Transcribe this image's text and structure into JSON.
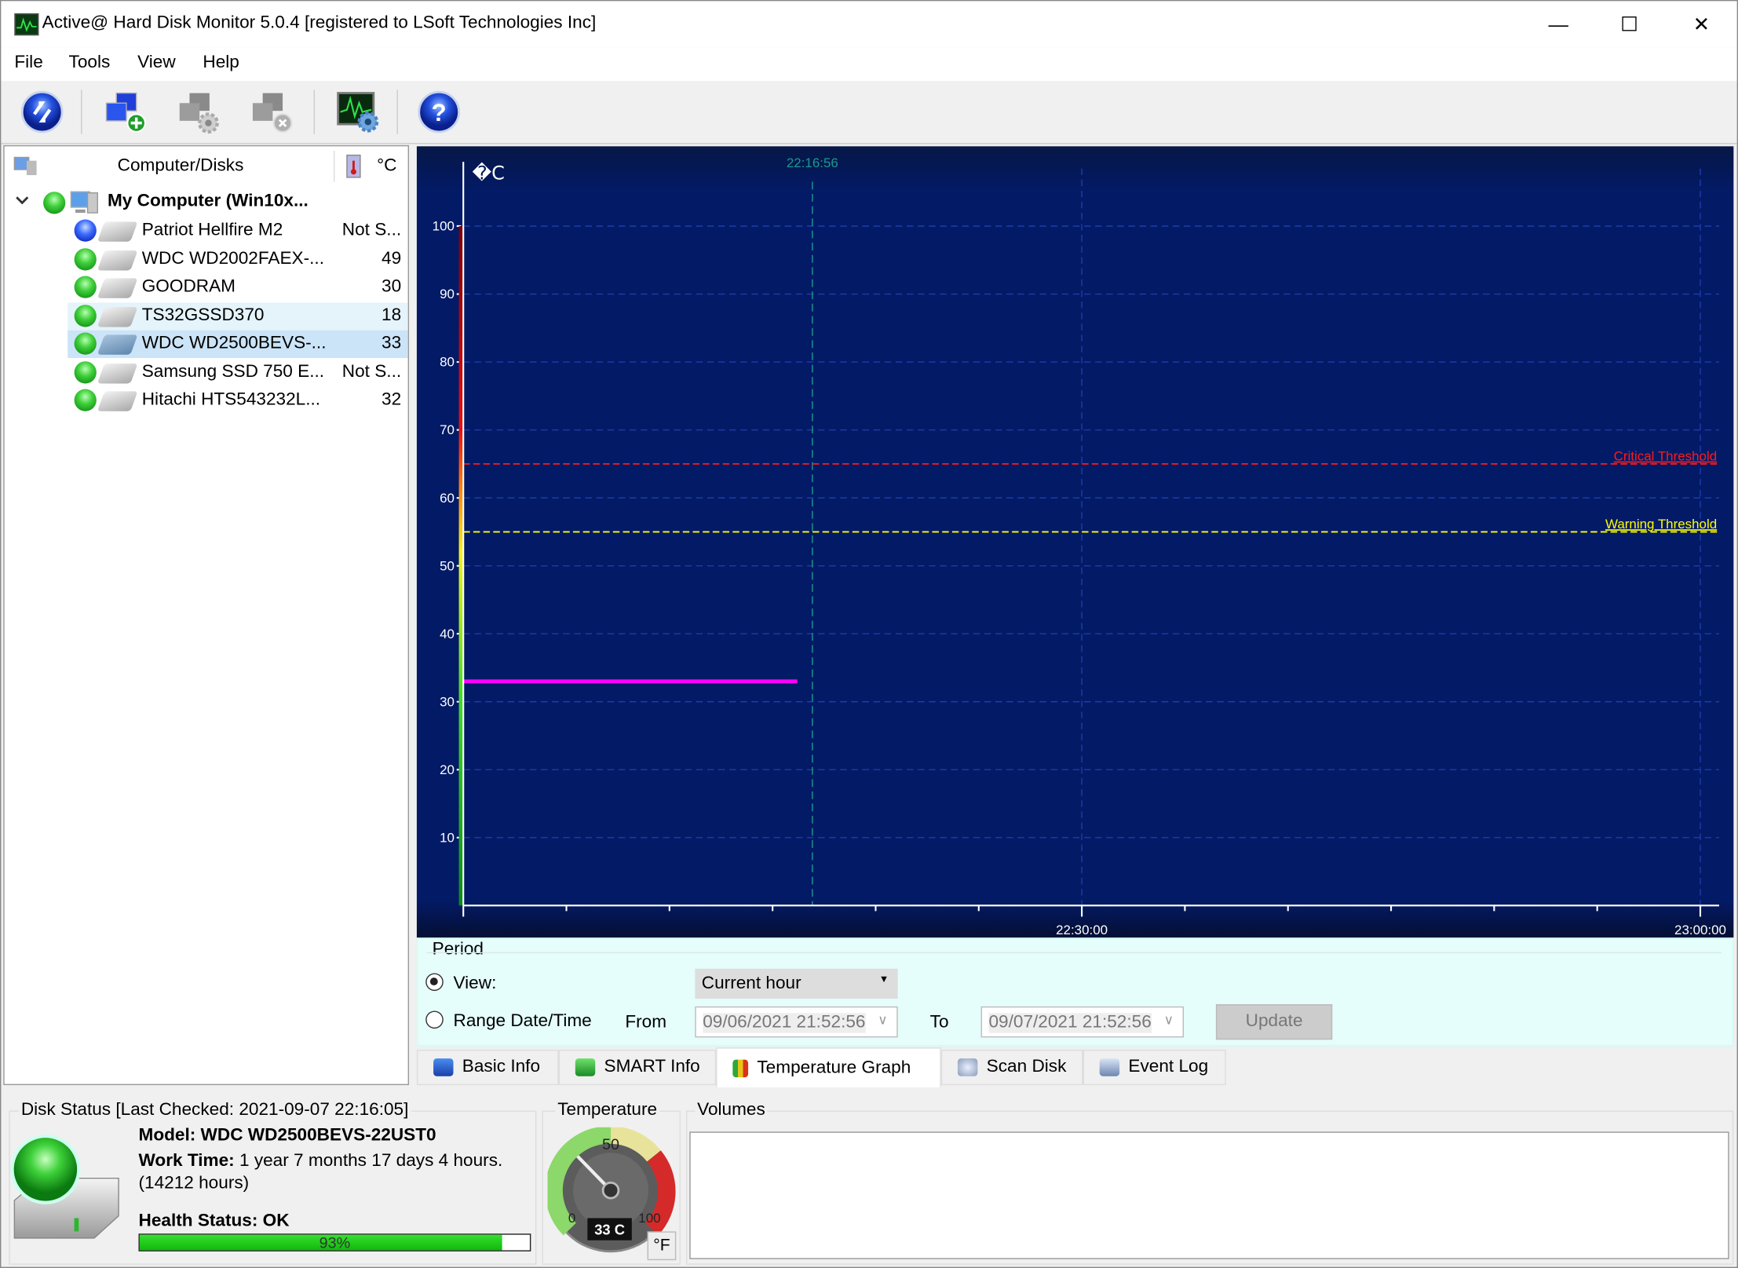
{
  "window": {
    "title": "Active@ Hard Disk Monitor 5.0.4 [registered to LSoft Technologies Inc]",
    "minimize_glyph": "—",
    "maximize_glyph": "☐",
    "close_glyph": "✕"
  },
  "menu": [
    "File",
    "Tools",
    "View",
    "Help"
  ],
  "toolbar": {
    "buttons": [
      {
        "name": "refresh",
        "icon": "refresh-icon"
      },
      {
        "name": "add-computer",
        "icon": "add-computer-icon"
      },
      {
        "name": "computer-settings",
        "icon": "computer-settings-icon"
      },
      {
        "name": "remove-computer",
        "icon": "remove-computer-icon"
      },
      {
        "name": "monitor-settings",
        "icon": "monitor-settings-icon"
      },
      {
        "name": "help",
        "icon": "help-icon"
      }
    ]
  },
  "tree": {
    "header_label": "Computer/Disks",
    "header_unit": "°C",
    "root": {
      "label": "My Computer (Win10x...",
      "status": "green",
      "expanded": true
    },
    "disks": [
      {
        "label": "Patriot Hellfire M2",
        "temp": "Not S...",
        "status": "blue",
        "state": ""
      },
      {
        "label": "WDC WD2002FAEX-...",
        "temp": "49",
        "status": "green",
        "state": ""
      },
      {
        "label": "GOODRAM",
        "temp": "30",
        "status": "green",
        "state": ""
      },
      {
        "label": "TS32GSSD370",
        "temp": "18",
        "status": "green",
        "state": "hover"
      },
      {
        "label": "WDC WD2500BEVS-...",
        "temp": "33",
        "status": "green",
        "state": "selected"
      },
      {
        "label": "Samsung SSD 750 E...",
        "temp": "Not S...",
        "status": "green",
        "state": ""
      },
      {
        "label": "Hitachi HTS543232L...",
        "temp": "32",
        "status": "green",
        "state": ""
      }
    ]
  },
  "chart_data": {
    "type": "line",
    "title": "",
    "ylabel": "�C",
    "xlabel": "",
    "ylim": [
      0,
      110
    ],
    "yticks": [
      10,
      20,
      30,
      40,
      50,
      60,
      70,
      80,
      90,
      100
    ],
    "xlim_minutes": [
      0,
      61
    ],
    "x_origin": "22:00:00",
    "xticks_minutes": [
      0,
      5,
      10,
      15,
      20,
      25,
      30,
      35,
      40,
      45,
      50,
      55,
      60
    ],
    "xtick_labels": {
      "30": "22:30:00",
      "60": "23:00:00"
    },
    "current_time_marker": {
      "label": "22:16:56",
      "minute": 16.93
    },
    "thresholds": [
      {
        "name": "Critical Threshold",
        "value": 65,
        "color": "#ff1a1a"
      },
      {
        "name": "Warning Threshold",
        "value": 55,
        "color": "#ffff00"
      }
    ],
    "series": [
      {
        "name": "WDC WD2500BEVS-22UST0",
        "color": "#ff00ff",
        "x_minutes": [
          0,
          16.2
        ],
        "values": [
          33,
          33
        ]
      }
    ],
    "grid": true,
    "legend": "none"
  },
  "period": {
    "title": "Period",
    "view_label": "View:",
    "view_selected": true,
    "view_value": "Current hour",
    "range_label": "Range Date/Time",
    "from_label": "From",
    "from_value": "09/06/2021 21:52:56",
    "to_label": "To",
    "to_value": "09/07/2021 21:52:56",
    "update_label": "Update"
  },
  "tabs": [
    {
      "label": "Basic Info",
      "icon": "book-icon",
      "active": false
    },
    {
      "label": "SMART Info",
      "icon": "smart-book-icon",
      "active": false
    },
    {
      "label": "Temperature Graph",
      "icon": "bar-chart-icon",
      "active": true
    },
    {
      "label": "Scan Disk",
      "icon": "magnifier-icon",
      "active": false
    },
    {
      "label": "Event Log",
      "icon": "event-log-icon",
      "active": false
    }
  ],
  "status": {
    "group_title": "Disk Status [Last Checked: 2021-09-07 22:16:05]",
    "model_label": "Model: WDC WD2500BEVS-22UST0",
    "work_time_label": "Work Time:",
    "work_time_value": " 1 year 7 months 17 days 4 hours.",
    "work_hours": "(14212 hours)",
    "health_label": "Health Status: OK",
    "health_percent": 93,
    "health_percent_text": "93%"
  },
  "temperature": {
    "group_title": "Temperature",
    "gauge_min": "0",
    "gauge_mid": "50",
    "gauge_max": "100",
    "value_text": "33 C",
    "value": 33,
    "unit_toggle": "°F"
  },
  "volumes": {
    "group_title": "Volumes"
  }
}
